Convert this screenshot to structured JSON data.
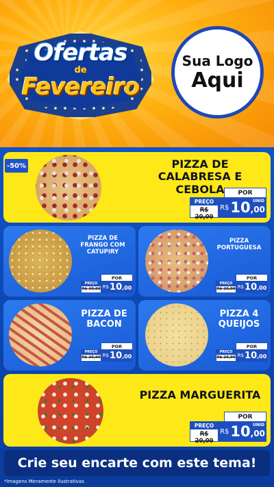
{
  "header": {
    "badge_line1": "Ofertas",
    "badge_line2": "de",
    "badge_line3": "Fevereiro",
    "logo_line1": "Sua Logo",
    "logo_line2": "Aqui"
  },
  "discount_badge": "-50%",
  "price_labels": {
    "preco": "PREÇO",
    "por": "POR",
    "currency": "R$",
    "unid": "UNID"
  },
  "products": [
    {
      "name": "PIZZA DE CALABRESA E CEBOLA",
      "old_price": "R$ 20,00",
      "price_int": "10",
      "price_dec": ",00"
    },
    {
      "name": "PIZZA DE FRANGO COM CATUPIRY",
      "old_price": "R$ 20,00",
      "price_int": "10",
      "price_dec": ",00"
    },
    {
      "name": "PIZZA PORTUGUESA",
      "old_price": "R$ 20,00",
      "price_int": "10",
      "price_dec": ",00"
    },
    {
      "name": "PIZZA DE BACON",
      "old_price": "R$ 20,00",
      "price_int": "10",
      "price_dec": ",00"
    },
    {
      "name": "PIZZA 4 QUEIJOS",
      "old_price": "R$ 20,00",
      "price_int": "10",
      "price_dec": ",00"
    },
    {
      "name": "PIZZA MARGUERITA",
      "old_price": "R$ 20,00",
      "price_int": "10",
      "price_dec": ",00"
    }
  ],
  "cta": "Crie seu encarte com este tema!",
  "footnote": "*Imagens Meramente Ilustrativas",
  "colors": {
    "accent_yellow": "#ffe817",
    "accent_blue": "#1d4fbf",
    "header_orange": "#ffb010"
  }
}
